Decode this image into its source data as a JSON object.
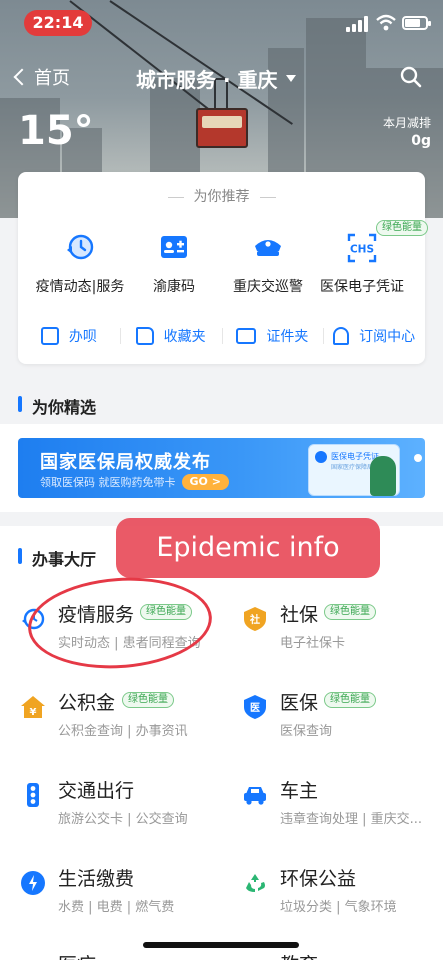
{
  "status": {
    "time": "22:14"
  },
  "nav": {
    "back_label": "首页",
    "title": "城市服务 · 重庆"
  },
  "weather": {
    "temperature": "15°"
  },
  "carbon": {
    "label": "本月减排",
    "value": "0g"
  },
  "recommend": {
    "heading": "为你推荐",
    "services": [
      {
        "label": "疫情动态|服务",
        "icon": "epidemic-clock-icon"
      },
      {
        "label": "渝康码",
        "icon": "health-code-icon"
      },
      {
        "label": "重庆交巡警",
        "icon": "police-cap-icon"
      },
      {
        "label": "医保电子凭证",
        "icon": "chs-icon",
        "badge": "绿色能量"
      }
    ],
    "quick_links": [
      {
        "label": "办呗",
        "icon": "document-icon"
      },
      {
        "label": "收藏夹",
        "icon": "folder-icon"
      },
      {
        "label": "证件夹",
        "icon": "id-card-icon"
      },
      {
        "label": "订阅中心",
        "icon": "bell-icon"
      }
    ]
  },
  "featured": {
    "heading": "为你精选",
    "banner_title": "国家医保局权威发布",
    "banner_subtitle": "领取医保码 就医购药免带卡",
    "banner_go": "GO",
    "banner_card_title": "医保电子凭证",
    "banner_card_sub": "国家医疗保障局"
  },
  "hall": {
    "heading": "办事大厅",
    "items": [
      {
        "title": "疫情服务",
        "badge": "绿色能量",
        "sub": "实时动态 | 患者同程查询",
        "icon": "epidemic-icon",
        "color": "#1677ff"
      },
      {
        "title": "社保",
        "badge": "绿色能量",
        "sub": "电子社保卡",
        "icon": "social-security-icon",
        "color": "#f0a422"
      },
      {
        "title": "公积金",
        "badge": "绿色能量",
        "sub": "公积金查询 | 办事资讯",
        "icon": "housing-fund-icon",
        "color": "#f0a422"
      },
      {
        "title": "医保",
        "badge": "绿色能量",
        "sub": "医保查询",
        "icon": "medical-insurance-icon",
        "color": "#1677ff"
      },
      {
        "title": "交通出行",
        "badge": "",
        "sub": "旅游公交卡 | 公交查询",
        "icon": "traffic-light-icon",
        "color": "#1677ff"
      },
      {
        "title": "车主",
        "badge": "",
        "sub": "违章查询处理 | 重庆交...",
        "icon": "car-icon",
        "color": "#1677ff"
      },
      {
        "title": "生活缴费",
        "badge": "",
        "sub": "水费 | 电费 | 燃气费",
        "icon": "water-drop-icon",
        "color": "#1677ff"
      },
      {
        "title": "环保公益",
        "badge": "",
        "sub": "垃圾分类 | 气象环境",
        "icon": "recycle-icon",
        "color": "#2bb673"
      },
      {
        "title": "医疗",
        "badge": "",
        "sub": "",
        "icon": "medical-icon",
        "color": "#1677ff"
      },
      {
        "title": "教育",
        "badge": "",
        "sub": "",
        "icon": "education-icon",
        "color": "#1677ff"
      }
    ]
  },
  "annotation": {
    "text": "Epidemic info"
  },
  "colors": {
    "accent": "#1677ff",
    "green": "#3aa651",
    "annotation": "#e84c5a"
  }
}
